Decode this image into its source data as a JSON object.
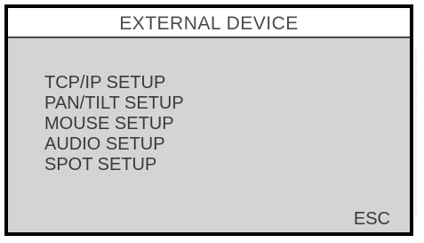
{
  "window": {
    "title": "EXTERNAL DEVICE"
  },
  "menu": {
    "items": [
      {
        "label": "TCP/IP SETUP"
      },
      {
        "label": "PAN/TILT SETUP"
      },
      {
        "label": "MOUSE SETUP"
      },
      {
        "label": "AUDIO SETUP"
      },
      {
        "label": "SPOT SETUP"
      }
    ]
  },
  "footer": {
    "esc_label": "ESC"
  },
  "colors": {
    "frame": "#000000",
    "title_background": "#ffffff",
    "content_background": "#d4d4d4",
    "text": "#3a3a3a"
  }
}
